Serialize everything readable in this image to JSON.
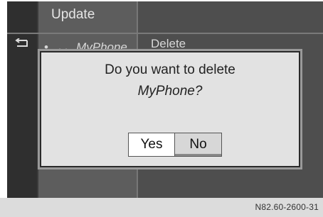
{
  "menu": {
    "items": [
      {
        "label": "Update"
      },
      {
        "label": "MyPhone",
        "bullet": "•",
        "phone_glyph": "ᆸ",
        "action": "Delete"
      }
    ],
    "back_icon": "back-arrow-icon"
  },
  "dialog": {
    "message": "Do you want to delete",
    "item_name": "MyPhone?",
    "buttons": {
      "yes": "Yes",
      "no": "No",
      "selected": "yes"
    }
  },
  "caption": "N82.60-2600-31",
  "colors": {
    "screen_bg": "#3b3b3b",
    "dialog_bg": "#e2e2e2",
    "selected_button_bg": "#ffffff"
  }
}
